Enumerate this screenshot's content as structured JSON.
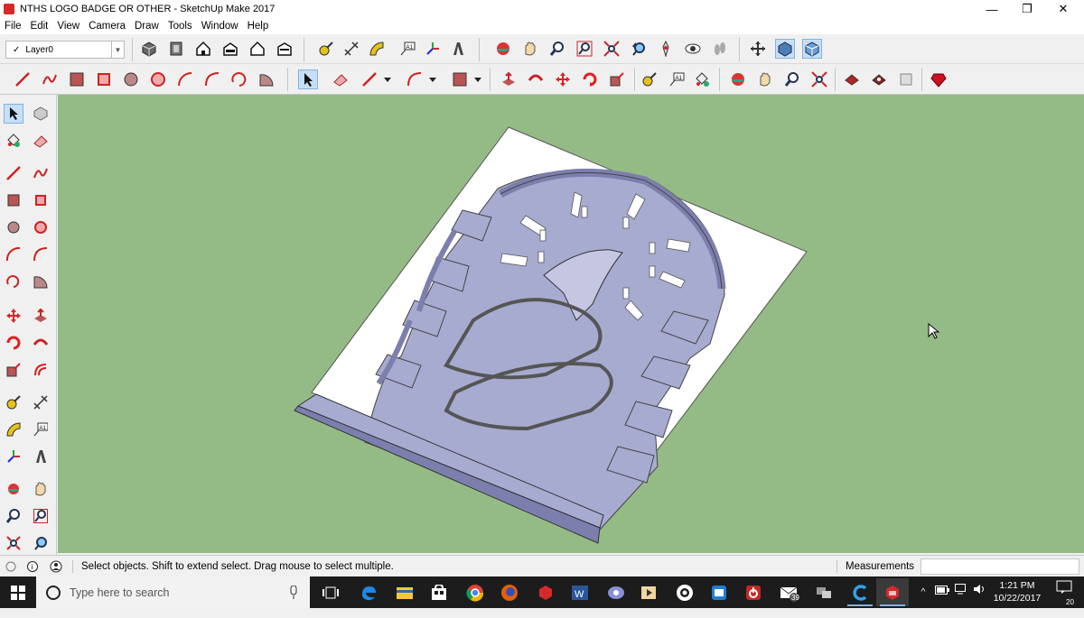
{
  "window": {
    "title": "NTHS LOGO BADGE OR OTHER - SketchUp Make 2017"
  },
  "window_controls": [
    "—",
    "❐",
    "✕"
  ],
  "menu": [
    "File",
    "Edit",
    "View",
    "Camera",
    "Draw",
    "Tools",
    "Window",
    "Help"
  ],
  "layer": {
    "check": "✓",
    "name": "Layer0"
  },
  "status": {
    "message": "Select objects. Shift to extend select. Drag mouse to select multiple.",
    "measurements_label": "Measurements",
    "measurements_value": ""
  },
  "taskbar": {
    "search_placeholder": "Type here to search",
    "time": "1:21 PM",
    "date": "10/22/2017",
    "notification_count": "20",
    "mail_badge": "39"
  },
  "colors": {
    "viewport_bg": "#94bb85",
    "model_face": "#a8abd0",
    "model_side": "#7c7fae",
    "base_plate": "#ffffff",
    "selected_tool": "#c7dff4"
  }
}
